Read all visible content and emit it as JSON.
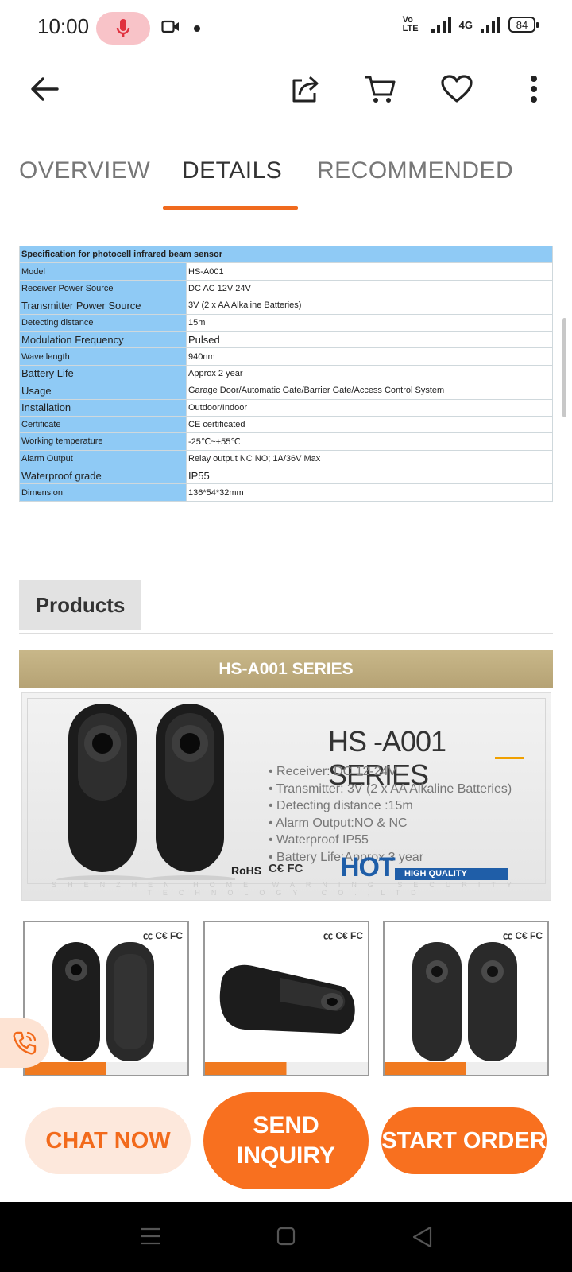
{
  "status_bar": {
    "time": "10:00",
    "volte": "Vo LTE",
    "network": "4G",
    "battery": "84"
  },
  "tabs": [
    {
      "label": "OVERVIEW",
      "active": false
    },
    {
      "label": "DETAILS",
      "active": true
    },
    {
      "label": "RECOMMENDED",
      "active": false
    }
  ],
  "spec_table": {
    "title": "Specification for photocell infrared beam sensor",
    "rows": [
      {
        "key": "Model",
        "value": "HS-A001"
      },
      {
        "key": "Receiver Power Source",
        "value": "DC AC 12V 24V"
      },
      {
        "key": "Transmitter Power Source",
        "value": "3V (2 x AA Alkaline Batteries)"
      },
      {
        "key": "Detecting distance",
        "value": "15m"
      },
      {
        "key": "Modulation Frequency",
        "value": "Pulsed"
      },
      {
        "key": "Wave length",
        "value": "940nm"
      },
      {
        "key": "Battery Life",
        "value": "Approx 2 year"
      },
      {
        "key": "Usage",
        "value": "Garage Door/Automatic Gate/Barrier Gate/Access Control System"
      },
      {
        "key": "Installation",
        "value": "Outdoor/Indoor"
      },
      {
        "key": "Certificate",
        "value": "CE certificated"
      },
      {
        "key": "Working temperature",
        "value": "-25℃~+55℃"
      },
      {
        "key": "Alarm Output",
        "value": "Relay output NC NO; 1A/36V Max"
      },
      {
        "key": "Waterproof grade",
        "value": "IP55"
      },
      {
        "key": "Dimension",
        "value": "136*54*32mm"
      }
    ]
  },
  "products": {
    "header": "Products",
    "series_bar": "HS-A001 SERIES",
    "banner": {
      "title": "HS -A001 SERIES",
      "bullets": [
        "Receiver: DC 12-24V",
        "Transmitter: 3V (2 x AA Alkaline Batteries)",
        "Detecting distance :15m",
        "Alarm Output:NO & NC",
        "Waterproof IP55",
        "Battery Life:Approx 3 year"
      ],
      "rohs": "RoHS",
      "certs": "C€ FC",
      "hot": "HOT",
      "high_quality": "HIGH QUALITY",
      "company": "SHENZHEN HOME WARNING SECURITY TECHNOLOGY CO.,LTD"
    },
    "thumb_cert": "㏄ C€ FC"
  },
  "actions": {
    "chat": "CHAT NOW",
    "send_line1": "SEND",
    "send_line2": "INQUIRY",
    "start": "START ORDER"
  },
  "colors": {
    "accent": "#f8701f",
    "table_key_bg": "#8fcaf5",
    "tab_underline": "#f06a1e"
  }
}
